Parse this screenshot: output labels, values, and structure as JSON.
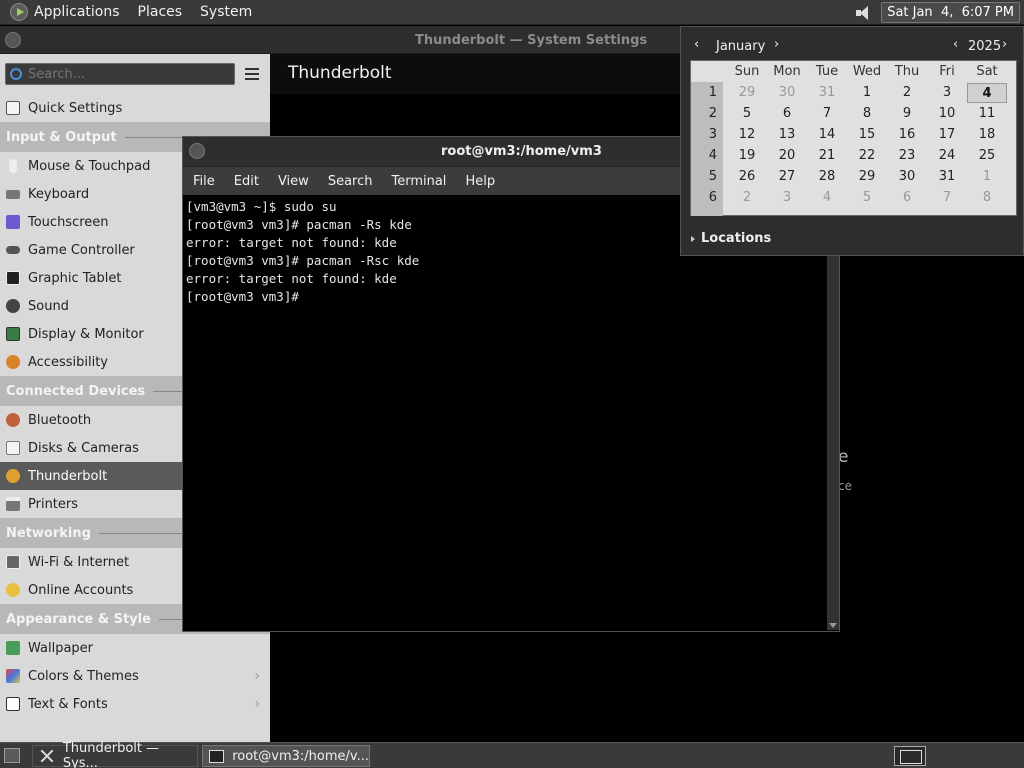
{
  "top_panel": {
    "menus": [
      "Applications",
      "Places",
      "System"
    ],
    "clock": "Sat Jan  4,  6:07 PM"
  },
  "settings": {
    "title": "Thunderbolt  — System Settings",
    "search_placeholder": "Search...",
    "content_title": "Thunderbolt",
    "bg_fragment_1": "e",
    "bg_fragment_2": "ce",
    "sidebar": {
      "quick_settings": "Quick Settings",
      "sections": [
        {
          "header": "Input & Output",
          "items": [
            "Mouse & Touchpad",
            "Keyboard",
            "Touchscreen",
            "Game Controller",
            "Graphic Tablet",
            "Sound",
            "Display & Monitor",
            "Accessibility"
          ]
        },
        {
          "header": "Connected Devices",
          "items": [
            "Bluetooth",
            "Disks & Cameras",
            "Thunderbolt",
            "Printers"
          ]
        },
        {
          "header": "Networking",
          "items": [
            "Wi-Fi & Internet",
            "Online Accounts"
          ]
        },
        {
          "header": "Appearance & Style",
          "items": [
            "Wallpaper",
            "Colors & Themes",
            "Text & Fonts"
          ]
        }
      ]
    }
  },
  "terminal": {
    "title": "root@vm3:/home/vm3",
    "menus": [
      "File",
      "Edit",
      "View",
      "Search",
      "Terminal",
      "Help"
    ],
    "output": "[vm3@vm3 ~]$ sudo su\n[root@vm3 vm3]# pacman -Rs kde\nerror: target not found: kde\n[root@vm3 vm3]# pacman -Rsc kde\nerror: target not found: kde\n[root@vm3 vm3]#"
  },
  "calendar": {
    "month": "January",
    "year": "2025",
    "prev": "‹",
    "next": "›",
    "weekdays": [
      "Sun",
      "Mon",
      "Tue",
      "Wed",
      "Thu",
      "Fri",
      "Sat"
    ],
    "weeks": [
      {
        "num": "1",
        "days": [
          "29",
          "30",
          "31",
          "1",
          "2",
          "3",
          "4"
        ]
      },
      {
        "num": "2",
        "days": [
          "5",
          "6",
          "7",
          "8",
          "9",
          "10",
          "11"
        ]
      },
      {
        "num": "3",
        "days": [
          "12",
          "13",
          "14",
          "15",
          "16",
          "17",
          "18"
        ]
      },
      {
        "num": "4",
        "days": [
          "19",
          "20",
          "21",
          "22",
          "23",
          "24",
          "25"
        ]
      },
      {
        "num": "5",
        "days": [
          "26",
          "27",
          "28",
          "29",
          "30",
          "31",
          "1"
        ]
      },
      {
        "num": "6",
        "days": [
          "2",
          "3",
          "4",
          "5",
          "6",
          "7",
          "8"
        ]
      }
    ],
    "locations": "Locations"
  },
  "taskbar": {
    "tasks": [
      "Thunderbolt — Sys...",
      "root@vm3:/home/v..."
    ]
  },
  "colors": {
    "sidebar_bg": "#d9d9d9",
    "panel_bg": "#3a3a3a",
    "selected_item": "#5a5a5a"
  }
}
